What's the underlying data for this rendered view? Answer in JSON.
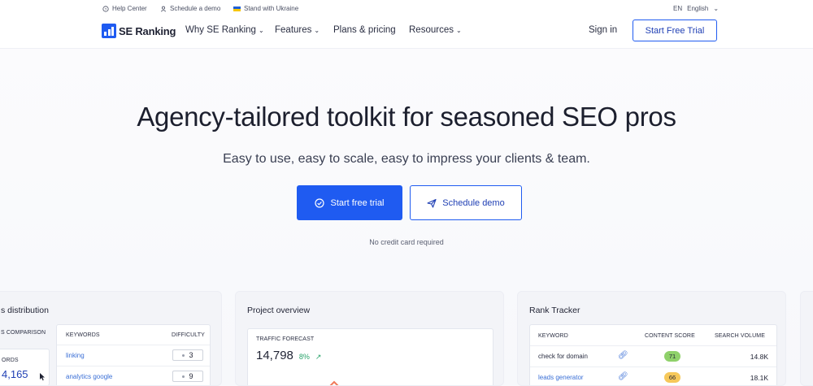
{
  "utility": {
    "help": "Help Center",
    "demo": "Schedule a demo",
    "ukraine": "Stand with Ukraine",
    "lang_code": "EN",
    "lang_name": "English"
  },
  "nav": {
    "logo": "SE Ranking",
    "items": [
      {
        "label": "Why SE Ranking",
        "dropdown": true
      },
      {
        "label": "Features",
        "dropdown": true
      },
      {
        "label": "Plans & pricing",
        "dropdown": false
      },
      {
        "label": "Resources",
        "dropdown": true
      }
    ],
    "signin": "Sign in",
    "cta": "Start Free Trial"
  },
  "hero": {
    "title": "Agency-tailored toolkit for seasoned SEO pros",
    "subtitle": "Easy to use, easy to scale, easy to impress your clients & team.",
    "primary": "Start free trial",
    "secondary": "Schedule demo",
    "note": "No credit card required"
  },
  "cards": {
    "distribution": {
      "title": "s distribution",
      "tab": "S COMPARISON",
      "stat_label": "ORDS",
      "stat_value": "4,165",
      "col_keywords": "KEYWORDS",
      "col_difficulty": "DIFFICULTY",
      "rows": [
        {
          "keyword": "linking",
          "difficulty": "3"
        },
        {
          "keyword": "analytics google",
          "difficulty": "9"
        }
      ]
    },
    "project": {
      "title": "Project overview",
      "label": "TRAFFIC FORECAST",
      "value": "14,798",
      "change": "8%"
    },
    "rank": {
      "title": "Rank Tracker",
      "col_keyword": "KEYWORD",
      "col_score": "CONTENT SCORE",
      "col_volume": "SEARCH VOLUME",
      "rows": [
        {
          "keyword": "check for domain",
          "score": "71",
          "volume": "14.8K",
          "score_color": "#8fd16a",
          "kw_color": "#2a2e42"
        },
        {
          "keyword": "leads generator",
          "score": "66",
          "volume": "18.1K",
          "score_color": "#f6c85a",
          "kw_color": "#3a6fd6"
        }
      ]
    }
  },
  "colors": {
    "accent": "#1f5bf1",
    "positive": "#29a36a"
  }
}
